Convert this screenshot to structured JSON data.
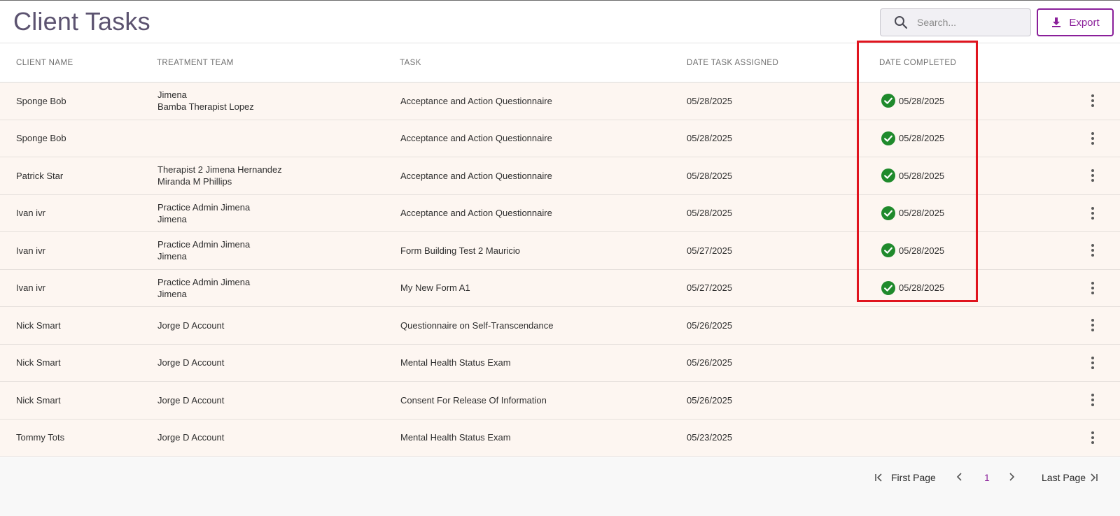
{
  "header": {
    "title": "Client Tasks",
    "search_placeholder": "Search...",
    "export_label": "Export"
  },
  "colors": {
    "title": "#5c5370",
    "accent": "#8a1f9a",
    "row_bg": "#fdf6f1",
    "complete_check": "#1f8a2c",
    "highlight": "#e0141e"
  },
  "table": {
    "columns": [
      "CLIENT NAME",
      "TREATMENT TEAM",
      "TASK",
      "DATE TASK ASSIGNED",
      "DATE COMPLETED"
    ],
    "rows": [
      {
        "client": "Sponge Bob",
        "team": [
          "Jimena",
          "Bamba Therapist Lopez"
        ],
        "task": "Acceptance and Action Questionnaire",
        "assigned": "05/28/2025",
        "completed": "05/28/2025"
      },
      {
        "client": "Sponge Bob",
        "team": [],
        "task": "Acceptance and Action Questionnaire",
        "assigned": "05/28/2025",
        "completed": "05/28/2025"
      },
      {
        "client": "Patrick Star",
        "team": [
          "Therapist 2 Jimena Hernandez",
          "Miranda M Phillips"
        ],
        "task": "Acceptance and Action Questionnaire",
        "assigned": "05/28/2025",
        "completed": "05/28/2025"
      },
      {
        "client": "Ivan ivr",
        "team": [
          "Practice Admin Jimena",
          "Jimena"
        ],
        "task": "Acceptance and Action Questionnaire",
        "assigned": "05/28/2025",
        "completed": "05/28/2025"
      },
      {
        "client": "Ivan ivr",
        "team": [
          "Practice Admin Jimena",
          "Jimena"
        ],
        "task": "Form Building Test 2 Mauricio",
        "assigned": "05/27/2025",
        "completed": "05/28/2025"
      },
      {
        "client": "Ivan ivr",
        "team": [
          "Practice Admin Jimena",
          "Jimena"
        ],
        "task": "My New Form A1",
        "assigned": "05/27/2025",
        "completed": "05/28/2025"
      },
      {
        "client": "Nick Smart",
        "team": [
          "Jorge D Account"
        ],
        "task": "Questionnaire on Self-Transcendance",
        "assigned": "05/26/2025",
        "completed": ""
      },
      {
        "client": "Nick Smart",
        "team": [
          "Jorge D Account"
        ],
        "task": "Mental Health Status Exam",
        "assigned": "05/26/2025",
        "completed": ""
      },
      {
        "client": "Nick Smart",
        "team": [
          "Jorge D Account"
        ],
        "task": "Consent For Release Of Information",
        "assigned": "05/26/2025",
        "completed": ""
      },
      {
        "client": "Tommy Tots",
        "team": [
          "Jorge D Account"
        ],
        "task": "Mental Health Status Exam",
        "assigned": "05/23/2025",
        "completed": ""
      }
    ]
  },
  "pagination": {
    "first_label": "First Page",
    "current_page": "1",
    "last_label": "Last Page"
  }
}
